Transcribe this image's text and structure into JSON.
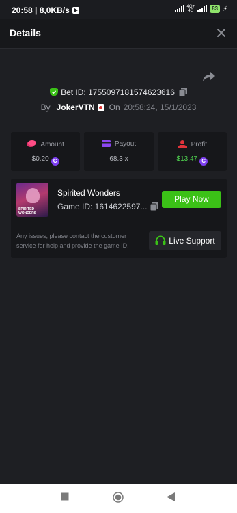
{
  "status_bar": {
    "time": "20:58 | 8,0KB/s",
    "network_label_top": "4G+",
    "network_label_bottom": "4G",
    "battery": "83"
  },
  "header": {
    "title": "Details",
    "close_icon": "close-icon"
  },
  "bet": {
    "bet_id_label": "Bet ID: 1755097181574623616",
    "by_label": "By",
    "username": "JokerVTN",
    "on_label": "On",
    "datetime": "20:58:24, 15/1/2023"
  },
  "stats": {
    "amount_label": "Amount",
    "amount_value": "$0.20",
    "payout_label": "Payout",
    "payout_value": "68.3 x",
    "profit_label": "Profit",
    "profit_value": "$13.47",
    "coin_symbol": "C"
  },
  "game": {
    "thumb_line1": "SPIRITED",
    "thumb_line2": "WONDERS",
    "name": "Spirited Wonders",
    "game_id": "Game ID: 1614622597...",
    "play_label": "Play Now",
    "issue_text": "Any issues, please contact the customer service for help and provide the game ID.",
    "live_support_label": "Live Support"
  },
  "colors": {
    "background": "#1e1f23",
    "card": "#16171a",
    "accent_green": "#3bc117",
    "profit_green": "#4fd34f",
    "coin_purple": "#7e3ff2"
  }
}
